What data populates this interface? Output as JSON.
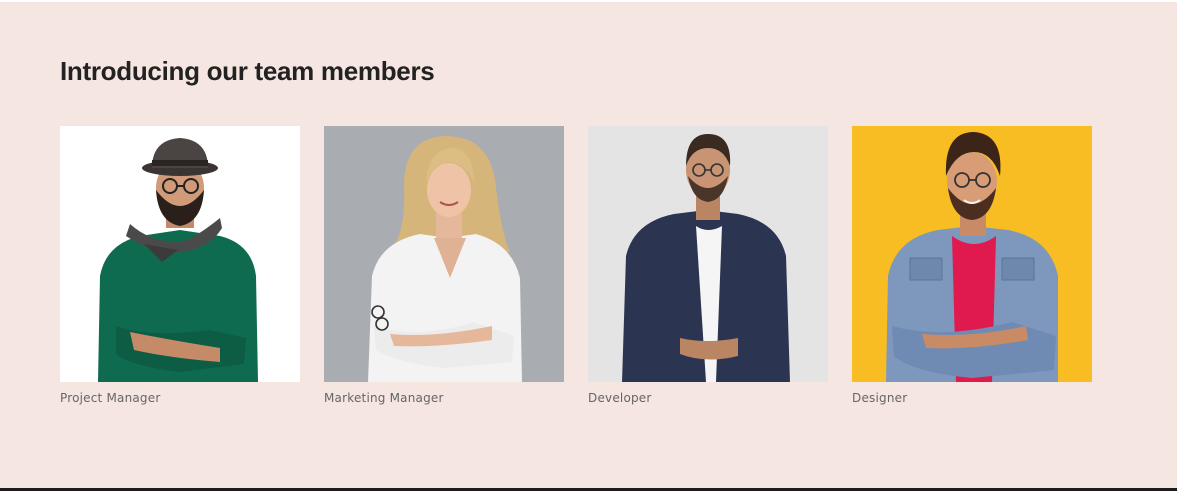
{
  "section": {
    "title": "Introducing our team members",
    "background": "#f5e6e2"
  },
  "team": [
    {
      "role": "Project Manager",
      "photo_background": "#ffffff"
    },
    {
      "role": "Marketing Manager",
      "photo_background": "#a9adb2"
    },
    {
      "role": "Developer",
      "photo_background": "#e4e4e4"
    },
    {
      "role": "Designer",
      "photo_background": "#f7bd22"
    }
  ]
}
